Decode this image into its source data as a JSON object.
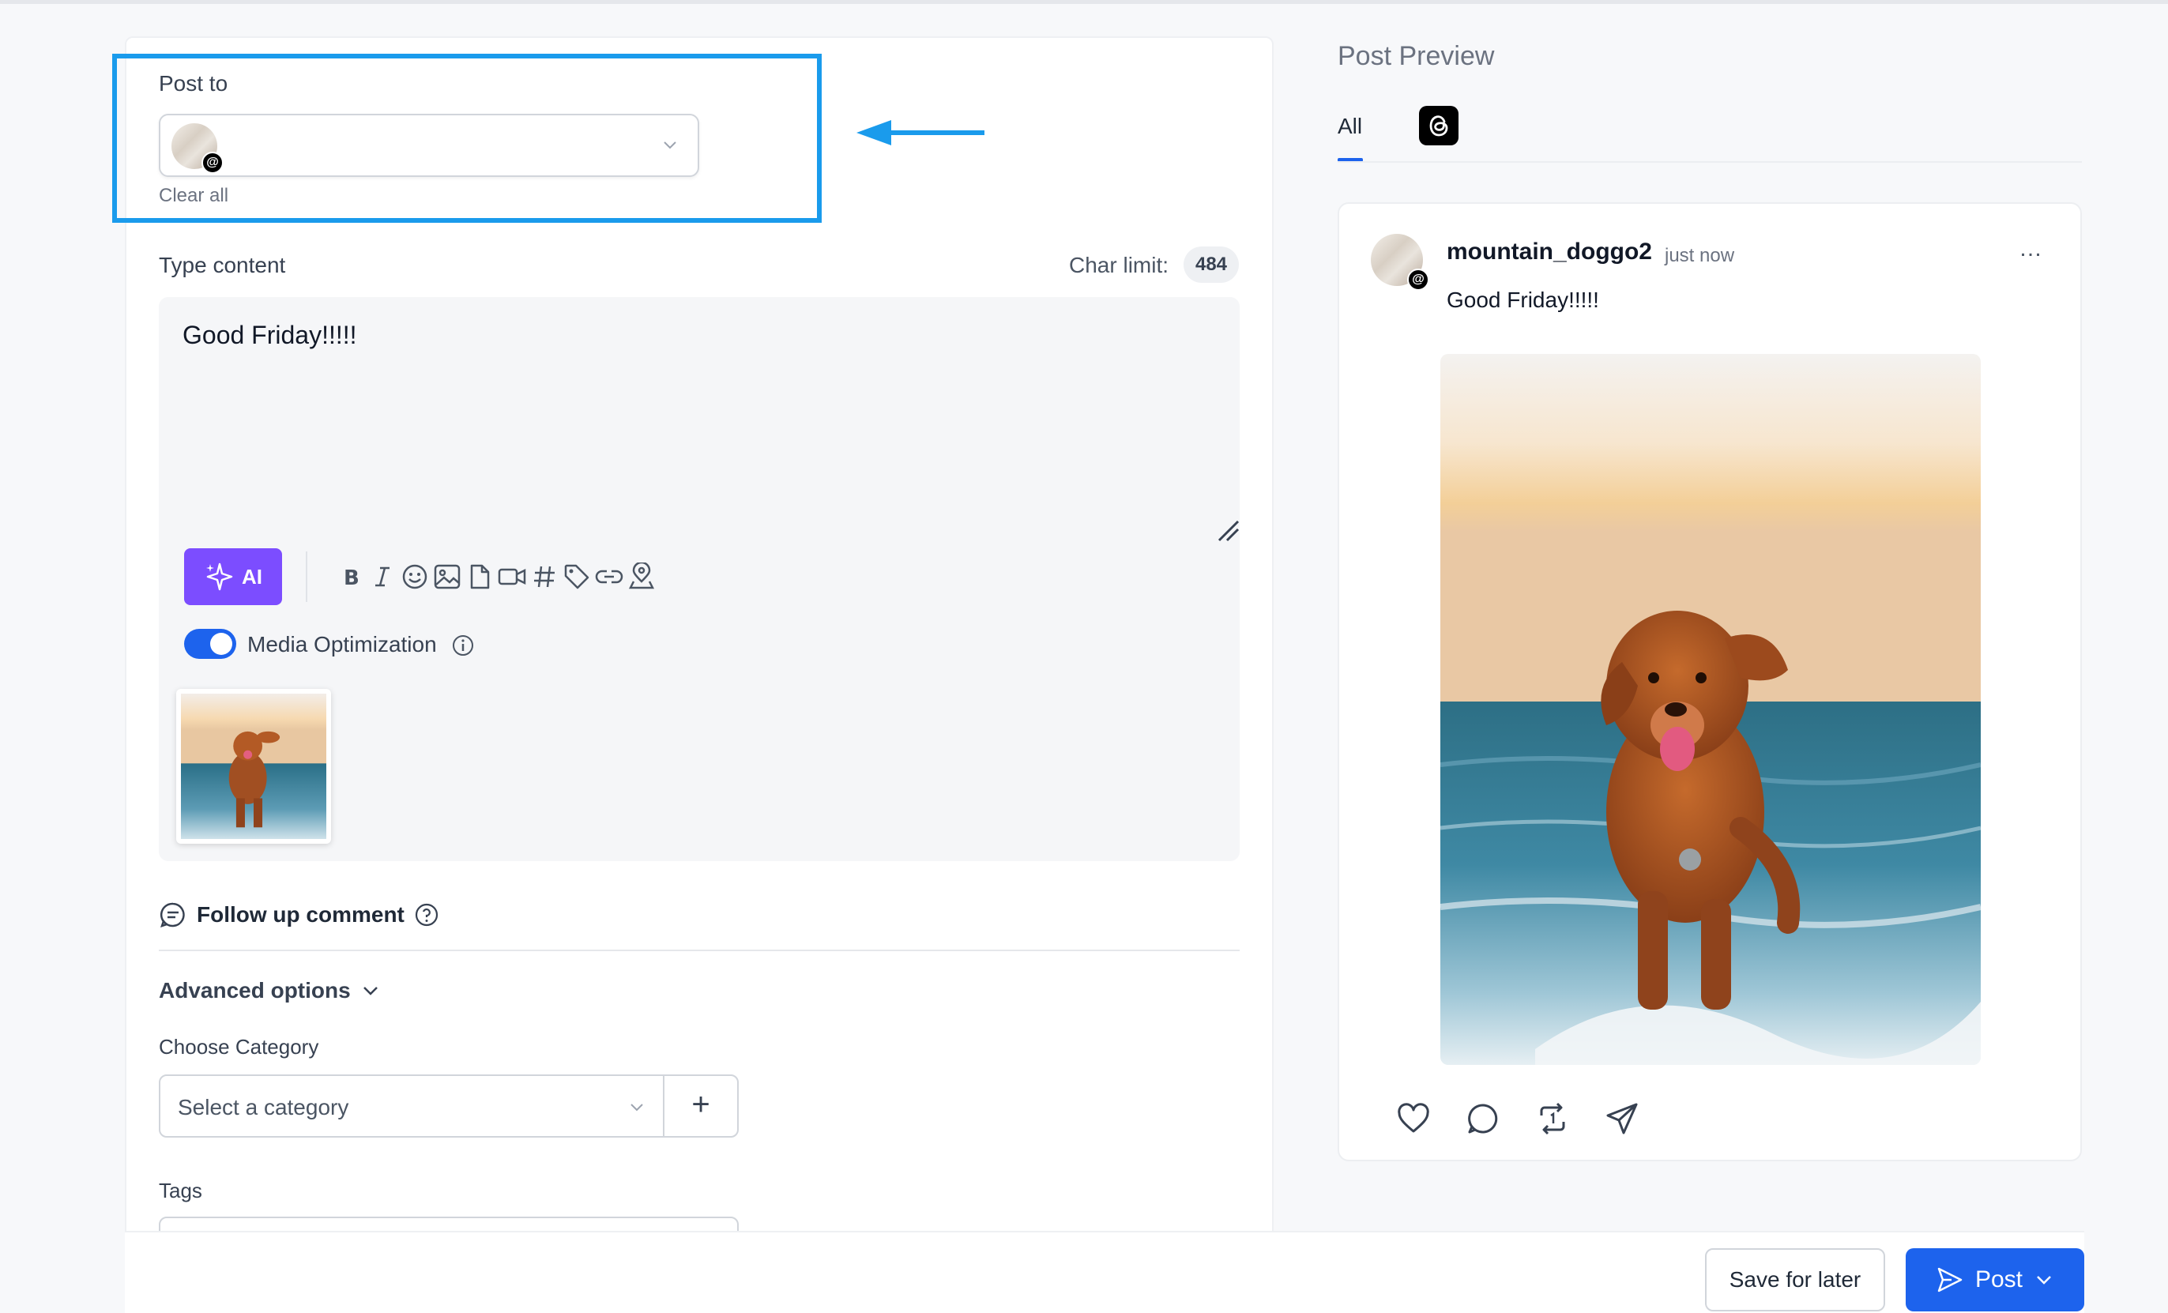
{
  "composer": {
    "post_to_label": "Post to",
    "clear_all": "Clear all",
    "type_content_label": "Type content",
    "char_limit_label": "Char limit:",
    "char_limit_value": "484",
    "content_text": "Good Friday!!!!!",
    "ai_label": "AI",
    "media_optimization_label": "Media Optimization",
    "media_optimization_enabled": true,
    "follow_up_label": "Follow up comment",
    "advanced_label": "Advanced options",
    "choose_category_label": "Choose Category",
    "category_placeholder": "Select a category",
    "add_label": "+",
    "tags_label": "Tags",
    "toolbar_icons": [
      "bold-icon",
      "italic-icon",
      "emoji-icon",
      "image-icon",
      "file-icon",
      "video-icon",
      "hashtag-icon",
      "tag-icon",
      "link-icon",
      "location-icon"
    ]
  },
  "preview": {
    "title": "Post Preview",
    "tab_all": "All",
    "username": "mountain_doggo2",
    "time": "just now",
    "more": "…",
    "text": "Good Friday!!!!!",
    "actions": [
      "heart-icon",
      "comment-icon",
      "repost-icon",
      "share-icon"
    ]
  },
  "footer": {
    "save_later": "Save for later",
    "post": "Post"
  },
  "colors": {
    "accent": "#1d63ed",
    "ai": "#7c4dff",
    "highlight": "#1a9bec"
  }
}
